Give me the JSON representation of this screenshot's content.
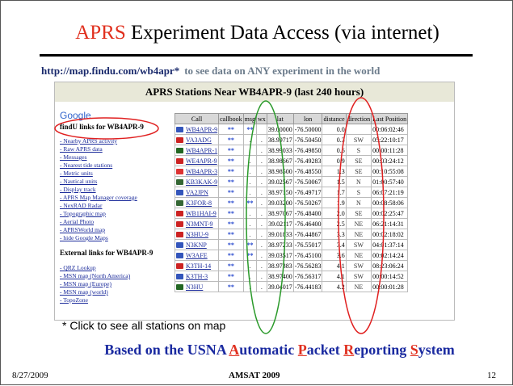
{
  "slide": {
    "title_highlight": "APRS",
    "title_rest": " Experiment Data Access (via internet)",
    "url": "http://map.findu.com/wb4apr*",
    "url_desc": "to see data on ANY experiment in the world",
    "note": "* Click to see all stations on map",
    "based": {
      "prefix": "Based on the USNA ",
      "w1_cap": "A",
      "w1_rest": "utomatic ",
      "w2_cap": "P",
      "w2_rest": "acket ",
      "w3_cap": "R",
      "w3_rest": "eporting ",
      "w4_cap": "S",
      "w4_rest": "ystem"
    },
    "footer_date": "8/27/2009",
    "footer_center": "AMSAT 2009",
    "footer_page": "12"
  },
  "shot": {
    "header": "APRS Stations Near WB4APR-9 (last 240 hours)",
    "google": "Google",
    "findu_heading": "findU links for WB4APR-9",
    "findu_links": [
      "- Nearby APRS activity",
      "- Raw APRS data",
      "- Messages",
      "- Nearest tide stations",
      "- Metric units",
      "- Nautical units",
      "- Display track",
      "- APRS Map Manager coverage",
      "- NexRAD Radar",
      "- Topographic map",
      "- Aerial Photo",
      "- APRSWorld map",
      "- hide Google Maps"
    ],
    "external_heading": "External links for WB4APR-9",
    "external_links": [
      "- QRZ Lookup",
      "- MSN map (North America)",
      "- MSN map (Europe)",
      "- MSN map (world)",
      "- TopoZone"
    ],
    "columns": [
      "Call",
      "callbook",
      "msg",
      "wx",
      "lat",
      "lon",
      "distance",
      "direction",
      "Last Position"
    ],
    "rows": [
      {
        "call": "WB4APR-9",
        "cb": "**",
        "msg": "**",
        "wx": "",
        "lat": "39.00000",
        "lon": "-76.50000",
        "dist": "0.0",
        "dir": "",
        "last": "00:06:02:46",
        "icon": "#3355bb"
      },
      {
        "call": "VA3ADG",
        "cb": "**",
        "msg": ".",
        "wx": ".",
        "lat": "38.99717",
        "lon": "-76.50450",
        "dist": "0.3",
        "dir": "SW",
        "last": "05:22:10:17",
        "icon": "#cc2222"
      },
      {
        "call": "WB4APR-1",
        "cb": "**",
        "msg": ".",
        "wx": ".",
        "lat": "38.99033",
        "lon": "-76.49850",
        "dist": "0.6",
        "dir": "S",
        "last": "00:00:11:28",
        "icon": "#226622"
      },
      {
        "call": "WE4APR-9",
        "cb": "**",
        "msg": ".",
        "wx": ".",
        "lat": "38.98667",
        "lon": "-76.49283",
        "dist": "0.9",
        "dir": "SE",
        "last": "00:03:24:12",
        "icon": "#cc2222"
      },
      {
        "call": "WB4APR-3",
        "cb": "**",
        "msg": ".",
        "wx": ".",
        "lat": "38.98500",
        "lon": "-76.48550",
        "dist": "1.3",
        "dir": "SE",
        "last": "00:10:55:08",
        "icon": "#dd3333"
      },
      {
        "call": "KB3KAK-9",
        "cb": "**",
        "msg": ".",
        "wx": ".",
        "lat": "39.02567",
        "lon": "-76.50067",
        "dist": "1.5",
        "dir": "N",
        "last": "01:00:57:40",
        "icon": "#336633"
      },
      {
        "call": "VA2JPN",
        "cb": "**",
        "msg": ".",
        "wx": ".",
        "lat": "38.97150",
        "lon": "-76.49717",
        "dist": "1.7",
        "dir": "S",
        "last": "06:07:21:19",
        "icon": "#3355bb"
      },
      {
        "call": "K3FOR-8",
        "cb": "**",
        "msg": "**",
        "wx": ".",
        "lat": "39.03200",
        "lon": "-76.50267",
        "dist": "1.9",
        "dir": "N",
        "last": "00:08:58:06",
        "icon": "#336633"
      },
      {
        "call": "WB1HAI-9",
        "cb": "**",
        "msg": ".",
        "wx": ".",
        "lat": "38.97067",
        "lon": "-76.48400",
        "dist": "2.0",
        "dir": "SE",
        "last": "00:02:25:47",
        "icon": "#cc2222"
      },
      {
        "call": "N3MNT-9",
        "cb": "**",
        "msg": ".",
        "wx": ".",
        "lat": "39.02117",
        "lon": "-76.46400",
        "dist": "2.5",
        "dir": "NE",
        "last": "06:21:14:31",
        "icon": "#cc2222"
      },
      {
        "call": "N3HU-9",
        "cb": "**",
        "msg": ".",
        "wx": ".",
        "lat": "39.01833",
        "lon": "-76.44867",
        "dist": "3.3",
        "dir": "NE",
        "last": "00:02:18:02",
        "icon": "#cc2222"
      },
      {
        "call": "N3KNP",
        "cb": "**",
        "msg": "**",
        "wx": ".",
        "lat": "38.97233",
        "lon": "-76.55017",
        "dist": "3.4",
        "dir": "SW",
        "last": "04:01:37:14",
        "icon": "#3355bb"
      },
      {
        "call": "W3AFE",
        "cb": "**",
        "msg": "**",
        "wx": ".",
        "lat": "39.03517",
        "lon": "-76.45100",
        "dist": "3.6",
        "dir": "NE",
        "last": "00:02:14:24",
        "icon": "#3355bb"
      },
      {
        "call": "K3TH-14",
        "cb": "**",
        "msg": ".",
        "wx": ".",
        "lat": "38.97383",
        "lon": "-76.56283",
        "dist": "4.1",
        "dir": "SW",
        "last": "08:23:06:24",
        "icon": "#cc2222"
      },
      {
        "call": "K3TH-3",
        "cb": "**",
        "msg": ".",
        "wx": ".",
        "lat": "38.97400",
        "lon": "-76.56317",
        "dist": "4.1",
        "dir": "SW",
        "last": "00:00:14:52",
        "icon": "#3355bb"
      },
      {
        "call": "N3HU",
        "cb": "**",
        "msg": ".",
        "wx": ".",
        "lat": "39.04017",
        "lon": "-76.44183",
        "dist": "4.2",
        "dir": "NE",
        "last": "00:00:01:28",
        "icon": "#226622"
      }
    ]
  },
  "colors": {
    "title_red": "#e0301e",
    "heading_blue": "#1a2aa0",
    "oval_green": "#2a9a2a",
    "oval_red": "#e02020"
  }
}
